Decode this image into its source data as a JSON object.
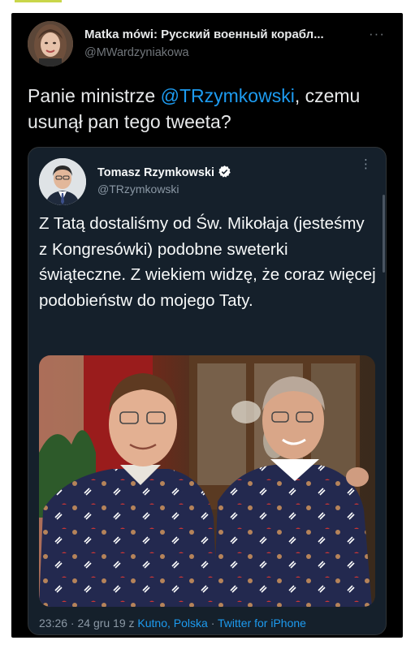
{
  "outer_tweet": {
    "author_name": "Matka mówi: Русский военный корабл...",
    "author_handle": "@MWardzyniakowa",
    "more_label": "···",
    "text_before": "Panie ministrze ",
    "mention": "@TRzymkowski",
    "text_after": ", czemu usunął pan tego tweeta?"
  },
  "quoted_tweet": {
    "author_name": "Tomasz Rzymkowski",
    "verified": true,
    "author_handle": "@TRzymkowski",
    "more_label": "⋮",
    "text": "Z Tatą dostaliśmy od Św. Mikołaja (jesteśmy z Kongresówki) podobne sweterki świąteczne. Z wiekiem widzę, że coraz więcej podobieństw do mojego Taty.",
    "meta": {
      "time_date": "23:26 · 24 gru 19 z ",
      "location": "Kutno, Polska",
      "separator": " · ",
      "source": "Twitter for iPhone"
    }
  },
  "colors": {
    "background": "#000000",
    "card_background": "#15202b",
    "accent": "#1d9bf0",
    "verified_badge": "#ffffff"
  },
  "icons": [
    "verified-badge-icon",
    "more-options-icon"
  ]
}
